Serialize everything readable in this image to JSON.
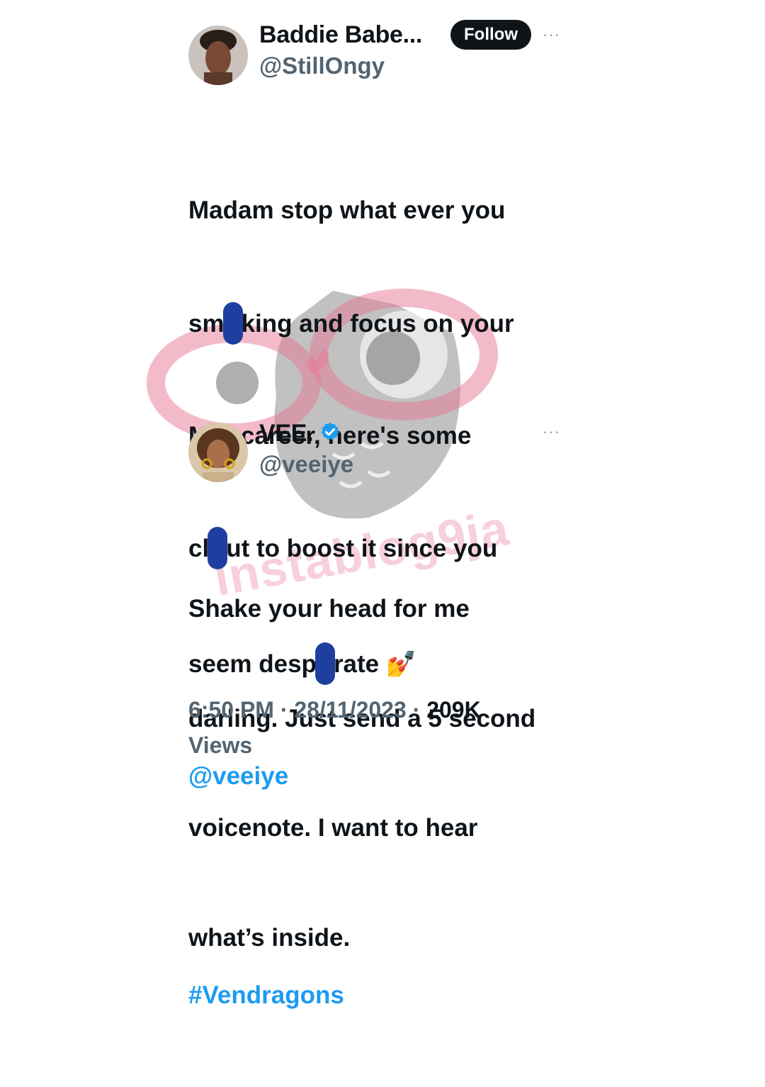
{
  "tweet1": {
    "name": "Baddie Babe...",
    "handle": "@StillOngy",
    "follow_label": "Follow",
    "more_label": "···",
    "lines": [
      {
        "a": "Madam stop what ever you",
        "b": ""
      },
      {
        "a": "sm",
        "b": "king and focus on your"
      },
      {
        "a": "MID career, here's some",
        "b": ""
      },
      {
        "a": "cl",
        "b": "ut to boost it since you"
      },
      {
        "a": "seem desp",
        "b": "rate"
      }
    ],
    "emoji": "💅",
    "mention": "@veeiye",
    "hashtag": "#Vendragons"
  },
  "tweet2": {
    "name": "VEE.",
    "handle": "@veeiye",
    "more_label": "···",
    "lines": [
      "Shake your head for me",
      "darling. Just send a 5 second",
      "voicenote. I want to hear",
      "what’s inside."
    ],
    "time": "6:50 PM",
    "sep": "·",
    "date": "28/11/2023",
    "views_count": "209K",
    "views_label": "Views"
  },
  "watermark": {
    "text": "instablog9ja"
  },
  "colors": {
    "link": "#1d9bf0",
    "verified": "#1d9bf0",
    "follow_bg": "#0f1419",
    "redaction": "#1f3fa0",
    "watermark_pink": "#e87896",
    "watermark_gray": "#9a9a9a"
  },
  "icons": [
    "more-icon",
    "verified-badge-icon",
    "nail-polish-emoji"
  ]
}
